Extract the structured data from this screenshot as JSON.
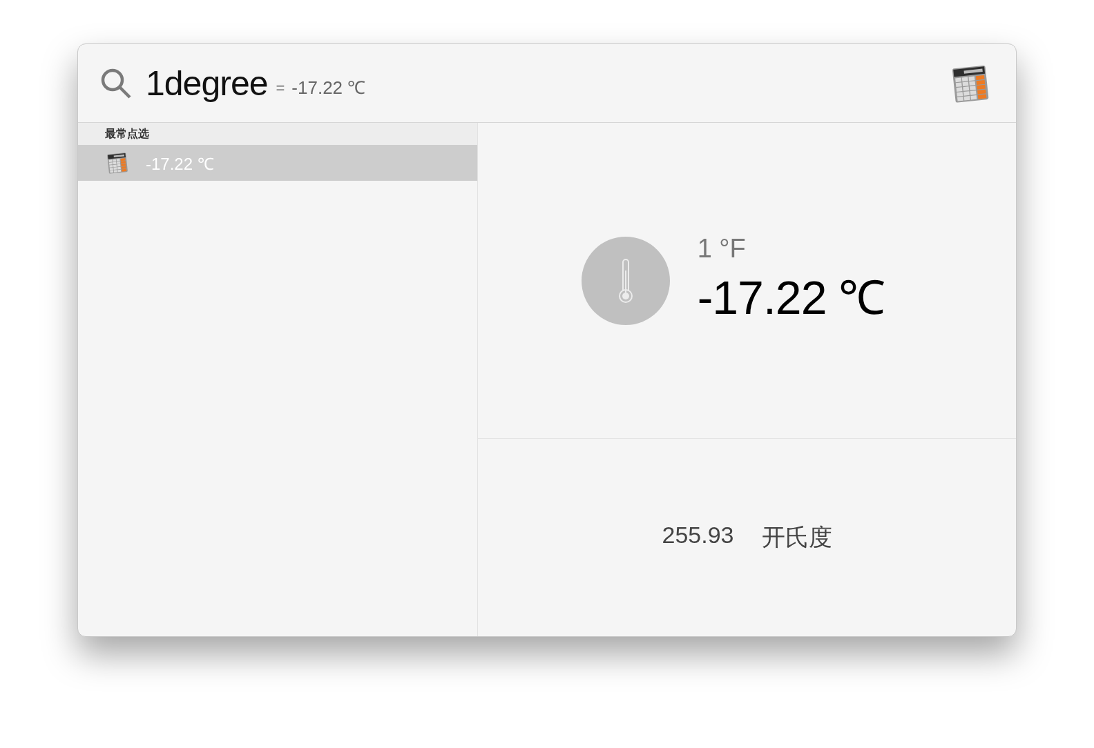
{
  "search": {
    "query": "1degree",
    "equals": "=",
    "answer": "-17.22 ℃"
  },
  "sidebar": {
    "section": "最常点选",
    "items": [
      {
        "label": "-17.22 ℃",
        "selected": true
      }
    ]
  },
  "preview": {
    "from": "1 °F",
    "result": "-17.22 ℃",
    "alternates": [
      {
        "value": "255.93",
        "unit": "开氏度"
      }
    ]
  }
}
